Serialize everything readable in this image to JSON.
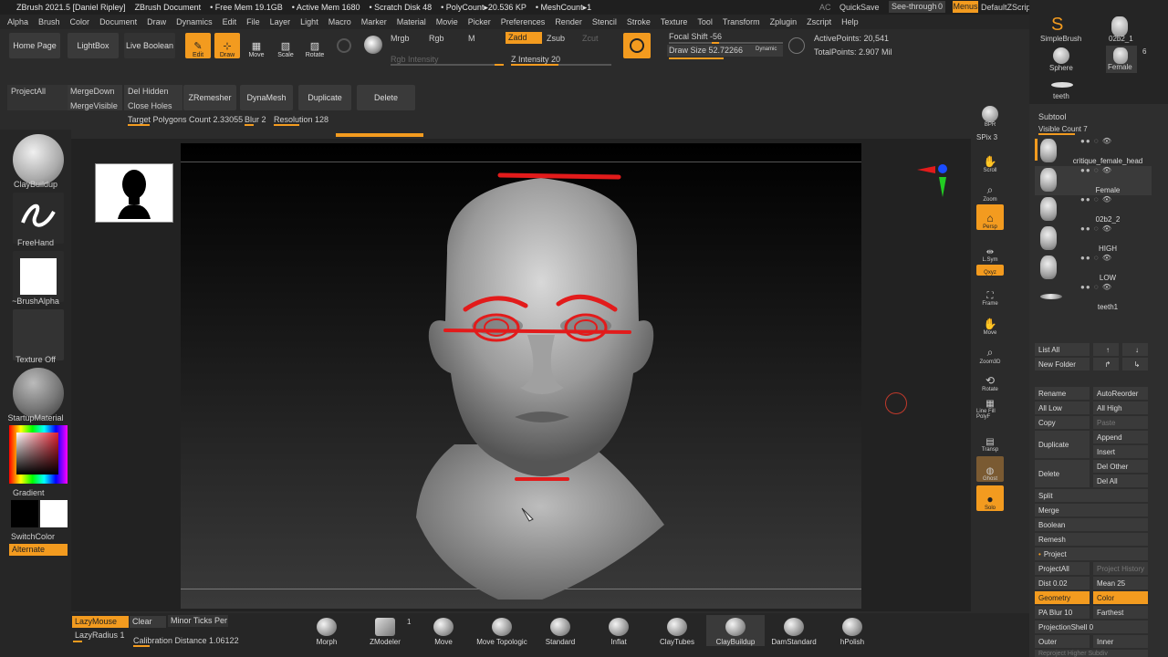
{
  "titlebar": {
    "app": "ZBrush 2021.5 [Daniel Ripley]",
    "document": "ZBrush Document",
    "free_mem": "• Free Mem 19.1GB",
    "active_mem": "• Active Mem 1680",
    "scratch": "• Scratch Disk 48",
    "polycount": "• PolyCount▸20.536 KP",
    "meshcount": "• MeshCount▸1",
    "ac": "AC",
    "quicksave": "QuickSave",
    "see_through": "See-through",
    "see_through_value": "0",
    "menus": "Menus",
    "script": "DefaultZScript"
  },
  "menubar": [
    "Alpha",
    "Brush",
    "Color",
    "Document",
    "Draw",
    "Dynamics",
    "Edit",
    "File",
    "Layer",
    "Light",
    "Macro",
    "Marker",
    "Material",
    "Movie",
    "Picker",
    "Preferences",
    "Render",
    "Stencil",
    "Stroke",
    "Texture",
    "Tool",
    "Transform",
    "Zplugin",
    "Zscript",
    "Help"
  ],
  "toolbar": {
    "home_page": "Home Page",
    "lightbox": "LightBox",
    "live_boolean": "Live Boolean",
    "edit": "Edit",
    "draw": "Draw",
    "move": "Move",
    "scale": "Scale",
    "rotate": "Rotate",
    "mrgb": "Mrgb",
    "rgb": "Rgb",
    "m": "M",
    "rgb_intensity": "Rgb Intensity",
    "zadd": "Zadd",
    "zsub": "Zsub",
    "zcut": "Zcut",
    "z_intensity": "Z Intensity 20",
    "focal_shift": "Focal Shift -56",
    "draw_size": "Draw Size 52.72266",
    "dynamic": "Dynamic",
    "active_points": "ActivePoints: 20,541",
    "total_points": "TotalPoints: 2.907 Mil",
    "project_all": "ProjectAll",
    "merge_down": "MergeDown",
    "merge_visible": "MergeVisible",
    "del_hidden": "Del Hidden",
    "close_holes": "Close Holes",
    "zremesher": "ZRemesher",
    "dynamesh": "DynaMesh",
    "duplicate": "Duplicate",
    "delete": "Delete",
    "target_polygons": "Target Polygons Count 2.33055",
    "blur": "Blur 2",
    "resolution": "Resolution 128"
  },
  "left_shelf": {
    "brush": "ClayBuildup",
    "stroke": "FreeHand",
    "alpha": "~BrushAlpha",
    "texture": "Texture Off",
    "material": "StartupMaterial",
    "gradient": "Gradient",
    "switch_color": "SwitchColor",
    "alternate": "Alternate"
  },
  "right_tools": {
    "bpr": "BPR",
    "spix": "SPix 3",
    "scroll": "Scroll",
    "zoom": "Zoom",
    "persp": "Persp",
    "lsym": "L.Sym",
    "xyz": "Qxyz",
    "frame": "Frame",
    "move": "Move",
    "zoom3d": "Zoom3D",
    "rotate": "Rotate",
    "polyf": "Line Fill PolyF",
    "transp": "Transp",
    "ghost": "Ghost",
    "solo": "Solo"
  },
  "right_panel": {
    "tool_simplebrush": "SimpleBrush",
    "tool_02b2": "02b2_1",
    "tool_count": "6",
    "tool_sphere": "Sphere",
    "tool_female": "Female",
    "tool_teeth": "teeth",
    "subtool_header": "Subtool",
    "visible_count": "Visible Count 7",
    "subtools": [
      "critique_female_head",
      "Female",
      "02b2_2",
      "HIGH",
      "LOW",
      "teeth1"
    ],
    "list_all": "List All",
    "new_folder": "New Folder",
    "rename": "Rename",
    "auto_reorder": "AutoReorder",
    "all_low": "All Low",
    "all_high": "All High",
    "copy": "Copy",
    "paste": "Paste",
    "duplicate": "Duplicate",
    "append": "Append",
    "insert": "Insert",
    "delete": "Delete",
    "del_other": "Del Other",
    "del_all": "Del All",
    "split": "Split",
    "merge": "Merge",
    "boolean": "Boolean",
    "remesh": "Remesh",
    "project": "Project",
    "project_all": "ProjectAll",
    "project_history": "Project History",
    "dist": "Dist 0.02",
    "mean": "Mean 25",
    "geometry": "Geometry",
    "color": "Color",
    "pa_blur": "PA Blur 10",
    "farthest": "Farthest",
    "projection_shell": "ProjectionShell 0",
    "outer": "Outer",
    "inner": "Inner",
    "reproject": "Reproject Higher Subdiv"
  },
  "bottom": {
    "lazymouse": "LazyMouse",
    "clear": "Clear",
    "minor_ticks": "Minor Ticks Per",
    "lazyradius": "LazyRadius 1",
    "calibration": "Calibration Distance 1.06122",
    "brushes": [
      "Morph",
      "ZModeler",
      "Move",
      "Move Topologic",
      "Standard",
      "Inflat",
      "ClayTubes",
      "ClayBuildup",
      "DamStandard",
      "hPolish"
    ],
    "zmodeler_count": "1"
  },
  "colors": {
    "accent": "#f39b1f",
    "annotation": "#e21b1b",
    "panel": "#2e2e2e"
  }
}
